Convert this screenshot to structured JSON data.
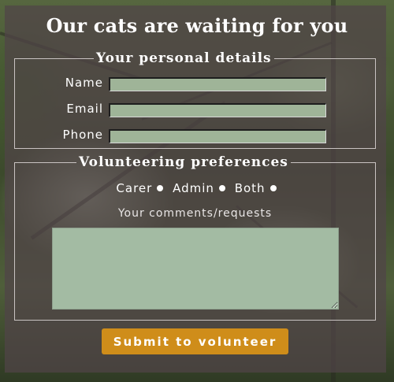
{
  "title": "Our cats are waiting for you",
  "personal": {
    "legend": "Your personal details",
    "fields": [
      {
        "label": "Name",
        "value": ""
      },
      {
        "label": "Email",
        "value": ""
      },
      {
        "label": "Phone",
        "value": ""
      }
    ]
  },
  "volunteering": {
    "legend": "Volunteering preferences",
    "options": [
      "Carer",
      "Admin",
      "Both"
    ],
    "comments_label": "Your comments/requests",
    "comments_value": ""
  },
  "submit_label": "Submit to volunteer",
  "colors": {
    "panel": "#504448",
    "field_bg": "#9fb498",
    "submit_bg": "#cf8d1a",
    "text": "#ffffff"
  }
}
